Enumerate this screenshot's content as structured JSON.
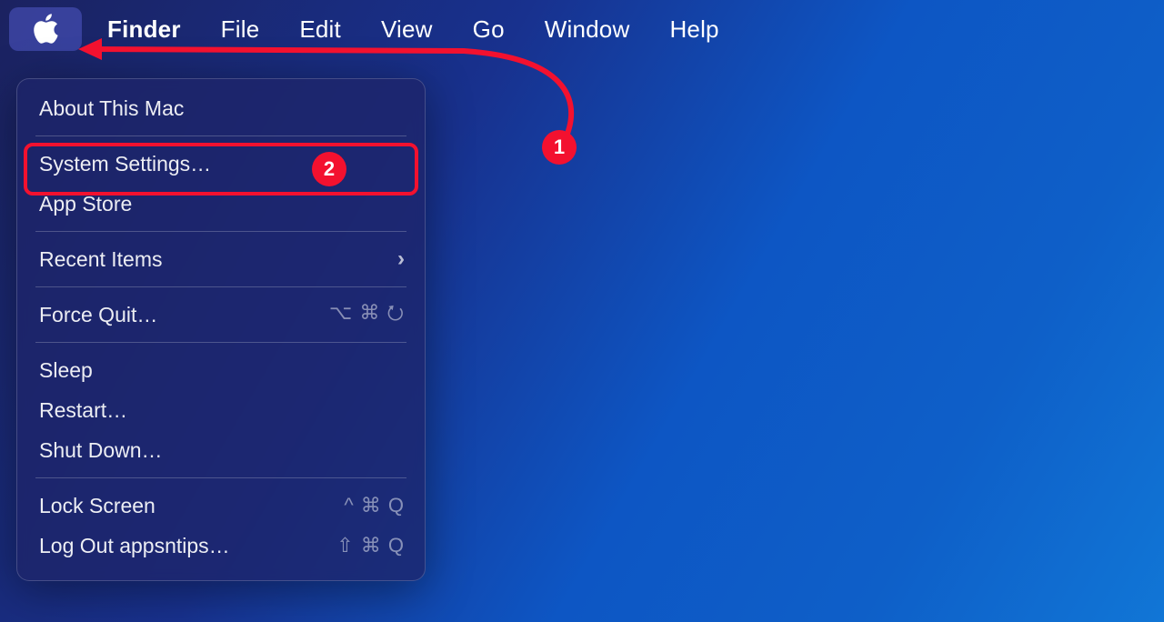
{
  "menubar": {
    "app_name": "Finder",
    "items": [
      "File",
      "Edit",
      "View",
      "Go",
      "Window",
      "Help"
    ]
  },
  "apple_menu": {
    "about": "About This Mac",
    "system_settings": "System Settings…",
    "app_store": "App Store",
    "recent_items": "Recent Items",
    "force_quit": "Force Quit…",
    "force_quit_shortcut": "⌥ ⌘ ⭮",
    "sleep": "Sleep",
    "restart": "Restart…",
    "shut_down": "Shut Down…",
    "lock_screen": "Lock Screen",
    "lock_screen_shortcut": "^ ⌘ Q",
    "log_out": "Log Out appsntips…",
    "log_out_shortcut": "⇧ ⌘ Q"
  },
  "annotations": {
    "badge1": "1",
    "badge2": "2"
  }
}
